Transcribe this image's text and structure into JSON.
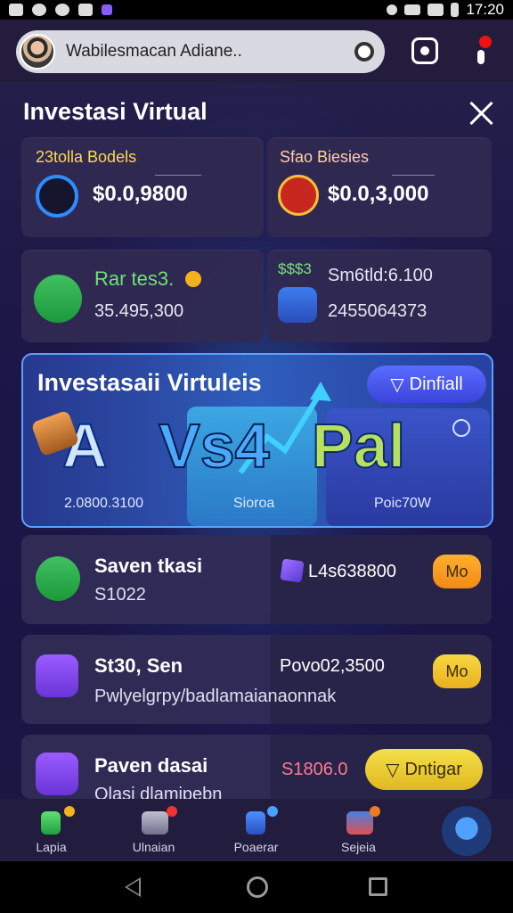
{
  "status_bar": {
    "time": "17:20"
  },
  "header": {
    "search_text": "Wabilesmacan Adiane.."
  },
  "page": {
    "title": "Investasi Virtual"
  },
  "cards": [
    {
      "label": "23tolla Bodels",
      "value": "$0.0,9800"
    },
    {
      "label": "Sfao Biesies",
      "value": "$0.0,3,000"
    },
    {
      "title": "Rar tes3.",
      "value": "35.495,300"
    },
    {
      "label": "$$$3",
      "title": "Sm6tld:6.100",
      "value": "2455064373"
    }
  ],
  "hero": {
    "title": "Investasaii Virtuleis",
    "button_label": "Dinfiall",
    "big_a": "A",
    "big_vs": "Vs4",
    "big_pal": "Pal",
    "seg1_value": "2.0800.3100",
    "seg2_label": "Sioroa",
    "seg3_label": "Poic70W"
  },
  "rows": [
    {
      "title": "Saven tkasi",
      "sub": "S1022",
      "mid": "L4s638800",
      "action": "Mo"
    },
    {
      "title": "St30, Sen",
      "sub": "Pwlyelgrpy/badlamaianaonnak",
      "mid": "Povo02,3500",
      "action": "Mo"
    },
    {
      "title": "Paven dasai",
      "sub": "Olasi dlamipebn",
      "mid": "S1806.0",
      "action": "Dntigar"
    }
  ],
  "bottom_nav": [
    {
      "label": "Lapia"
    },
    {
      "label": "Ulnaian"
    },
    {
      "label": "Poaerar"
    },
    {
      "label": "Sejeia"
    }
  ]
}
